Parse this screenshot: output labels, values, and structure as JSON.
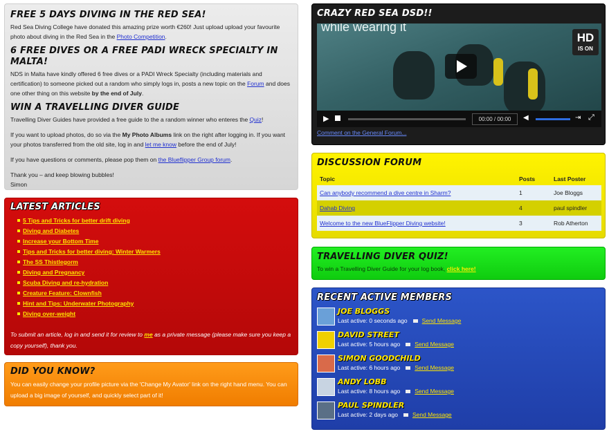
{
  "intro": {
    "section1_title": "FREE 5 DAYS DIVING IN THE RED SEA!",
    "section1_text_a": "Red Sea Diving College have donated this amazing prize worth €260! Just upload upload your favourite photo about diving in the Red Sea in the ",
    "section1_link": "Photo Competition",
    "section1_text_b": ".",
    "section2_title": "6 FREE DIVES OR A FREE PADI WRECK SPECIALTY IN MALTA!",
    "section2_text_a": "NDS in Malta have kindly offered 6 free dives or a PADI Wreck Specialty (including materials and certification) to someone picked out a random who simply logs in, posts a new topic on the ",
    "section2_link": "Forum",
    "section2_text_b": " and does one other thing on this website ",
    "section2_bold": "by the end of July",
    "section2_text_c": ".",
    "section3_title": "WIN A TRAVELLING DIVER GUIDE",
    "section3_text_a": "Travelling Diver Guides have provided a free guide to the a random winner who enteres the ",
    "section3_link": "Quiz",
    "section3_text_b": "!",
    "upload_text_a": "If you want to upload photos, do so via the ",
    "upload_bold": "My Photo Albums",
    "upload_text_b": " link on the right after logging in. If you want your photos transferred from the old site, log in and ",
    "upload_link": "let me know",
    "upload_text_c": " before the end of July!",
    "questions_text_a": "If you have questions or comments, please pop them on ",
    "questions_link": "the Blueflipper Group forum",
    "questions_text_b": ".",
    "thanks": "Thank you – and keep blowing bubbles!",
    "signature": "Simon"
  },
  "articles": {
    "title": "LATEST ARTICLES",
    "items": [
      "5 Tips and Tricks for better drift diving",
      "Diving and Diabetes",
      "Increase your Bottom Time",
      "Tips and Tricks for better diving: Winter Warmers",
      "The SS Thistlegorm",
      "Diving and Pregnancy",
      "Scuba Diving and re-hydration",
      "Creature Feature: Clownfish",
      "Hint and Tips: Underwater Photography",
      "Diving over-weight"
    ],
    "note_a": "To submit an article, log in and send it for review to ",
    "note_link": "me",
    "note_b": " as a private message (please make sure you keep a copy yourself), thank you."
  },
  "didyouknow": {
    "title": "DID YOU KNOW?",
    "text": "You can easily change your profile picture via the 'Change My Avator' link on the right hand menu. You can upload a big image of yourself, and quickly select part of it!"
  },
  "video": {
    "title": "CRAZY RED SEA DSD!!",
    "overlay_text": "while wearing it",
    "hd_label": "HD",
    "hd_sub": "IS ON",
    "time": "00:00 / 00:00",
    "comment_link": "Comment on the General Forum..."
  },
  "forum": {
    "title": "DISCUSSION FORUM",
    "headers": [
      "Topic",
      "Posts",
      "Last Poster"
    ],
    "rows": [
      {
        "topic": "Can anybody recommend a dive centre in Sharm?",
        "posts": "1",
        "poster": "Joe Bloggs"
      },
      {
        "topic": "Dahab Diving",
        "posts": "4",
        "poster": "paul spindler"
      },
      {
        "topic": "Welcome to the new BlueFlipper Diving website!",
        "posts": "3",
        "poster": "Rob Atherton"
      }
    ]
  },
  "quiz": {
    "title": "TRAVELLING DIVER QUIZ!",
    "text": "To win a Travelling Diver Guide for your log book, ",
    "link": "click here!"
  },
  "members": {
    "title": "RECENT ACTIVE MEMBERS",
    "send_label": "Send Message",
    "items": [
      {
        "name": "JOE BLOGGS",
        "active": "Last active: 0 seconds ago",
        "color": "#6aa0d8"
      },
      {
        "name": "DAVID STREET",
        "active": "Last active: 5 hours ago",
        "color": "#f0d000"
      },
      {
        "name": "SIMON GOODCHILD",
        "active": "Last active: 6 hours ago",
        "color": "#d96a4a"
      },
      {
        "name": "ANDY LOBB",
        "active": "Last active: 8 hours ago",
        "color": "#c8d4e2"
      },
      {
        "name": "PAUL SPINDLER",
        "active": "Last active: 2 days ago",
        "color": "#5a6f86"
      }
    ]
  }
}
